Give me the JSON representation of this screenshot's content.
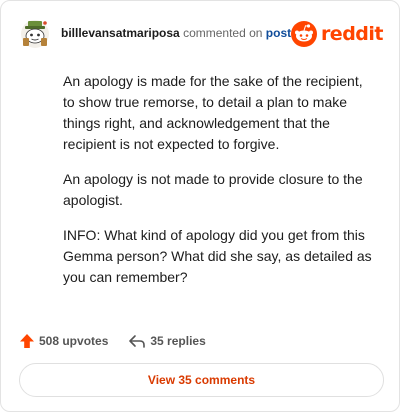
{
  "comment": {
    "username": "billlevansatmariposa",
    "action_text": "commented on",
    "post_link": "post",
    "paragraphs": [
      "An apology is made for the sake of the recipient, to show true remorse, to detail a plan to make things right, and acknowledgement that the recipient is not expected to forgive.",
      "An apology is not made to provide closure to the apologist.",
      "INFO: What kind of apology did you get from this Gemma person? What did she say, as detailed as you can remember?"
    ]
  },
  "brand": {
    "name": "reddit",
    "color": "#ff4500"
  },
  "stats": {
    "upvotes": "508 upvotes",
    "replies": "35 replies"
  },
  "view_comments": {
    "label": "View 35 comments"
  },
  "icons": {
    "avatar": "snoo-avatar",
    "brand": "reddit-logo-icon",
    "upvote": "upvote-arrow-icon",
    "reply": "reply-arrow-icon"
  },
  "colors": {
    "accent": "#ff4500",
    "link": "#0f4c9a",
    "button_text": "#d93a00"
  }
}
